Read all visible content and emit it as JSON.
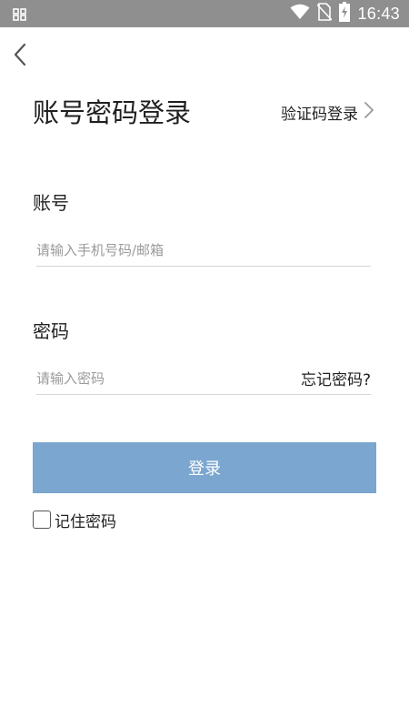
{
  "status_bar": {
    "time": "16:43",
    "icons": [
      "grid-icon",
      "wifi-icon",
      "no-sim-icon",
      "battery-charging-icon"
    ]
  },
  "header": {
    "back_icon": "chevron-left-icon",
    "title": "账号密码登录",
    "sms_login_label": "验证码登录",
    "sms_login_icon": "chevron-right-icon"
  },
  "account": {
    "label": "账号",
    "placeholder": "请输入手机号码/邮箱",
    "value": ""
  },
  "password": {
    "label": "密码",
    "placeholder": "请输入密码",
    "value": "",
    "forgot_label": "忘记密码?"
  },
  "login_button": {
    "label": "登录",
    "color": "#7aa6cf"
  },
  "remember": {
    "label": "记住密码",
    "checked": false
  }
}
